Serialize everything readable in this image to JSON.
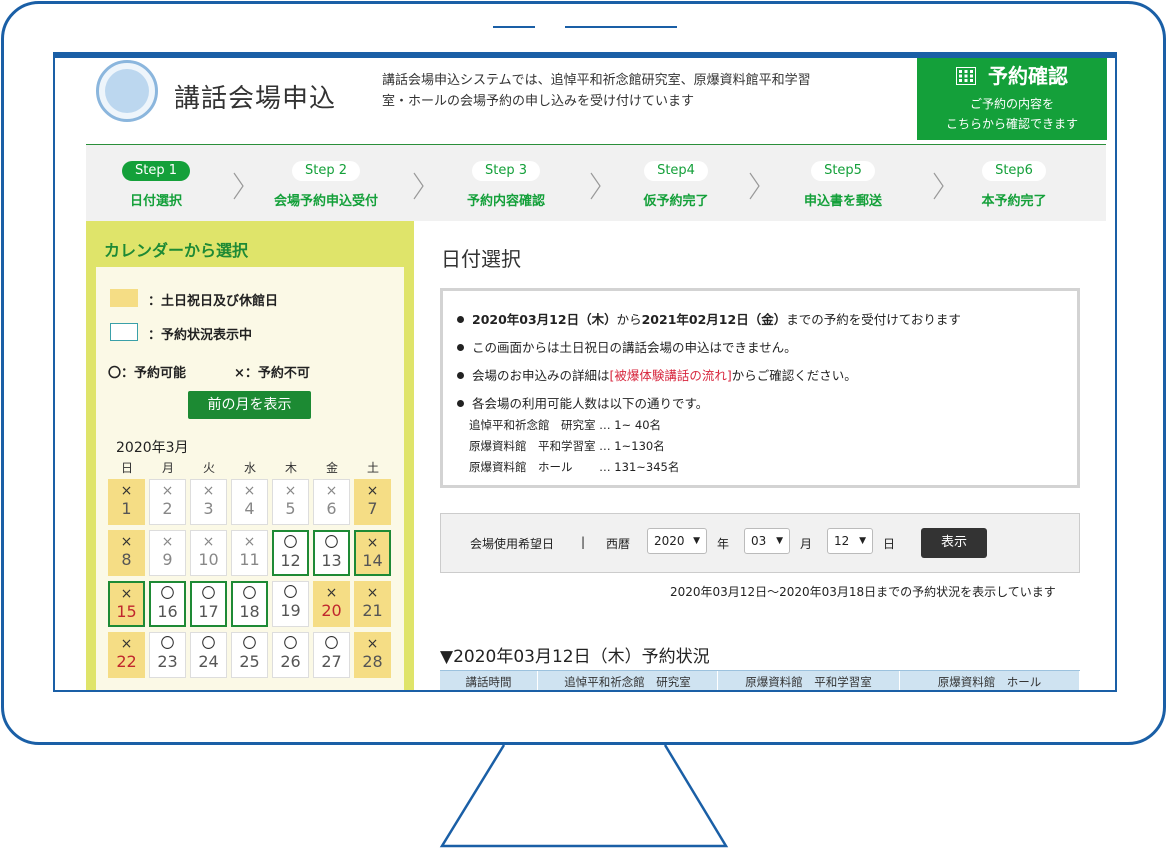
{
  "header": {
    "title": "講話会場申込",
    "description": "講話会場申込システムでは、追悼平和祈念館研究室、原爆資料館平和学習室・ホールの会場予約の申し込みを受け付けています",
    "confirm": {
      "title": "予約確認",
      "sub1": "ご予約の内容を",
      "sub2": "こちらから確認できます"
    }
  },
  "steps": [
    {
      "badge": "Step 1",
      "label": "日付選択"
    },
    {
      "badge": "Step 2",
      "label": "会場予約申込受付"
    },
    {
      "badge": "Step 3",
      "label": "予約内容確認"
    },
    {
      "badge": "Step4",
      "label": "仮予約完了"
    },
    {
      "badge": "Step5",
      "label": "申込書を郵送"
    },
    {
      "badge": "Step6",
      "label": "本予約完了"
    }
  ],
  "sidebar": {
    "title": "カレンダーから選択",
    "legend_holiday": "：土日祝日及び休館日",
    "legend_showing": "：予約状況表示中",
    "legend_available": "〇：予約可能",
    "legend_unavailable": "×：予約不可",
    "prev_month": "前の月を表示",
    "month_label": "2020年3月",
    "weekdays": [
      "日",
      "月",
      "火",
      "水",
      "木",
      "金",
      "土"
    ],
    "days": [
      {
        "day": "1",
        "mark": "×",
        "type": "holiday"
      },
      {
        "day": "2",
        "mark": "×",
        "type": "past"
      },
      {
        "day": "3",
        "mark": "×",
        "type": "past"
      },
      {
        "day": "4",
        "mark": "×",
        "type": "past"
      },
      {
        "day": "5",
        "mark": "×",
        "type": "past"
      },
      {
        "day": "6",
        "mark": "×",
        "type": "past"
      },
      {
        "day": "7",
        "mark": "×",
        "type": "holiday"
      },
      {
        "day": "8",
        "mark": "×",
        "type": "holiday"
      },
      {
        "day": "9",
        "mark": "×",
        "type": "past"
      },
      {
        "day": "10",
        "mark": "×",
        "type": "past"
      },
      {
        "day": "11",
        "mark": "×",
        "type": "past"
      },
      {
        "day": "12",
        "mark": "〇",
        "type": "showing"
      },
      {
        "day": "13",
        "mark": "〇",
        "type": "showing"
      },
      {
        "day": "14",
        "mark": "×",
        "type": "holiday-showing"
      },
      {
        "day": "15",
        "mark": "×",
        "type": "holiday-showing-red"
      },
      {
        "day": "16",
        "mark": "〇",
        "type": "showing"
      },
      {
        "day": "17",
        "mark": "〇",
        "type": "showing"
      },
      {
        "day": "18",
        "mark": "〇",
        "type": "showing"
      },
      {
        "day": "19",
        "mark": "〇",
        "type": "normal"
      },
      {
        "day": "20",
        "mark": "×",
        "type": "holiday-red"
      },
      {
        "day": "21",
        "mark": "×",
        "type": "holiday"
      },
      {
        "day": "22",
        "mark": "×",
        "type": "holiday-red"
      },
      {
        "day": "23",
        "mark": "〇",
        "type": "normal"
      },
      {
        "day": "24",
        "mark": "〇",
        "type": "normal"
      },
      {
        "day": "25",
        "mark": "〇",
        "type": "normal"
      },
      {
        "day": "26",
        "mark": "〇",
        "type": "normal"
      },
      {
        "day": "27",
        "mark": "〇",
        "type": "normal"
      },
      {
        "day": "28",
        "mark": "×",
        "type": "holiday"
      }
    ]
  },
  "main": {
    "title": "日付選択",
    "info": {
      "line1_start": "2020年03月12日（木）",
      "line1_mid": "から",
      "line1_end": "2021年02月12日（金）",
      "line1_tail": "までの予約を受付けております",
      "line2": "この画面からは土日祝日の講話会場の申込はできません。",
      "line3_pre": "会場のお申込みの詳細は",
      "line3_link": "[被爆体験講話の流れ]",
      "line3_post": "からご確認ください。",
      "line4": "各会場の利用可能人数は以下の通りです。",
      "cap1": "追悼平和祈念館　研究室 … 1~ 40名",
      "cap2": "原爆資料館　平和学習室 … 1~130名",
      "cap3": "原爆資料館　ホール　　 … 131~345名"
    },
    "form": {
      "label": "会場使用希望日",
      "sep": "|",
      "era": "西暦",
      "year": "2020",
      "year_unit": "年",
      "month": "03",
      "month_unit": "月",
      "day": "12",
      "day_unit": "日",
      "submit": "表示"
    },
    "range_note": "2020年03月12日～2020年03月18日までの予約状況を表示しています",
    "status_title": "▼2020年03月12日（木）予約状況",
    "table_headers": [
      "講話時間",
      "追悼平和祈念館　研究室",
      "原爆資料館　平和学習室",
      "原爆資料館　ホール"
    ]
  },
  "colors": {
    "brand_green": "#14a03a",
    "frame_blue": "#1a5fa6",
    "holiday": "#f5dd85",
    "sidebar": "#dfe46a"
  }
}
